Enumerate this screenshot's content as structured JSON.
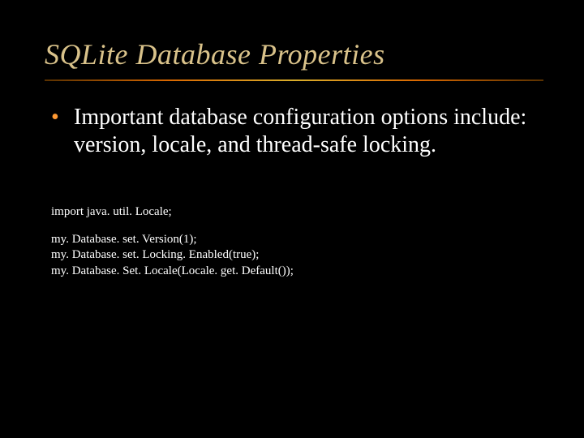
{
  "title": "SQLite Database Properties",
  "bullet": "Important database configuration options include: version, locale, and thread-safe locking.",
  "code": {
    "l1": "import java. util. Locale;",
    "l2": "my. Database. set. Version(1);",
    "l3": "my. Database. set. Locking. Enabled(true);",
    "l4": "my. Database. Set. Locale(Locale. get. Default());"
  }
}
